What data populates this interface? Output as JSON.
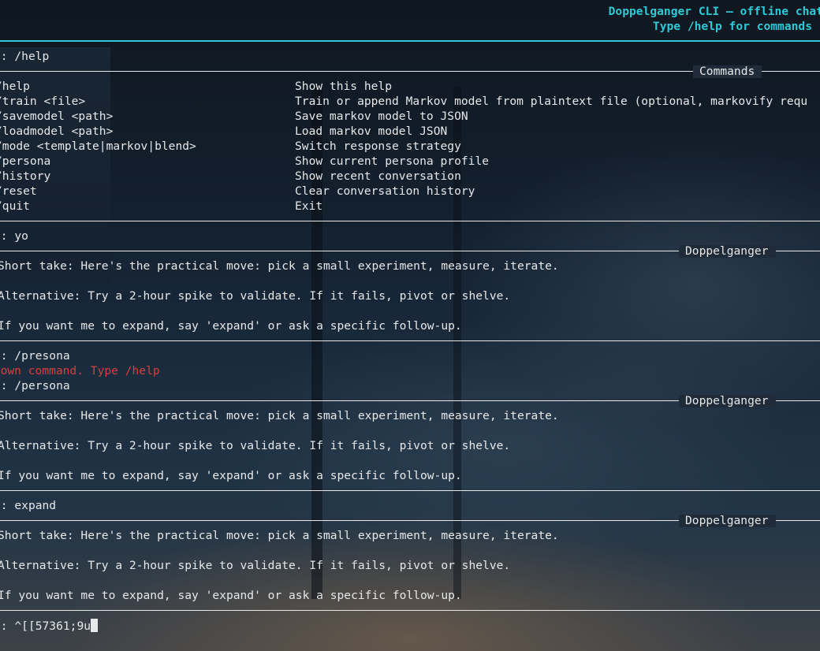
{
  "header": {
    "title": "Doppelganger CLI — offline chat",
    "subtitle": "Type /help for commands"
  },
  "prompt_prefix": "u:",
  "turns": [
    {
      "prompt": "/help"
    },
    {
      "prompt": "yo"
    },
    {
      "prompt": "/presona",
      "error": "known command. Type /help"
    },
    {
      "prompt": "/persona"
    },
    {
      "prompt": "expand"
    }
  ],
  "commands_panel": {
    "label": "Commands",
    "rows": [
      {
        "command": "/help",
        "description": "Show this help"
      },
      {
        "command": "/train <file>",
        "description": "Train or append Markov model from plaintext file (optional, markovify requ"
      },
      {
        "command": "/savemodel <path>",
        "description": "Save markov model to JSON"
      },
      {
        "command": "/loadmodel <path>",
        "description": "Load markov model JSON"
      },
      {
        "command": "/mode <template|markov|blend>",
        "description": "Switch response strategy"
      },
      {
        "command": "/persona",
        "description": "Show current persona profile"
      },
      {
        "command": "/history",
        "description": "Show recent conversation"
      },
      {
        "command": "/reset",
        "description": "Clear conversation history"
      },
      {
        "command": "/quit",
        "description": "Exit"
      }
    ]
  },
  "replies": [
    {
      "label": "Doppelganger",
      "lines": [
        "Short take: Here's the practical move: pick a small experiment, measure, iterate.",
        "Alternative: Try a 2-hour spike to validate. If it fails, pivot or shelve.",
        "If you want me to expand, say 'expand' or ask a specific follow-up."
      ]
    },
    {
      "label": "Doppelganger",
      "lines": [
        "Short take: Here's the practical move: pick a small experiment, measure, iterate.",
        "Alternative: Try a 2-hour spike to validate. If it fails, pivot or shelve.",
        "If you want me to expand, say 'expand' or ask a specific follow-up."
      ]
    },
    {
      "label": "Doppelganger",
      "lines": [
        "Short take: Here's the practical move: pick a small experiment, measure, iterate.",
        "Alternative: Try a 2-hour spike to validate. If it fails, pivot or shelve.",
        "If you want me to expand, say 'expand' or ask a specific follow-up."
      ]
    }
  ],
  "input": {
    "value": "^[[57361;9u"
  }
}
